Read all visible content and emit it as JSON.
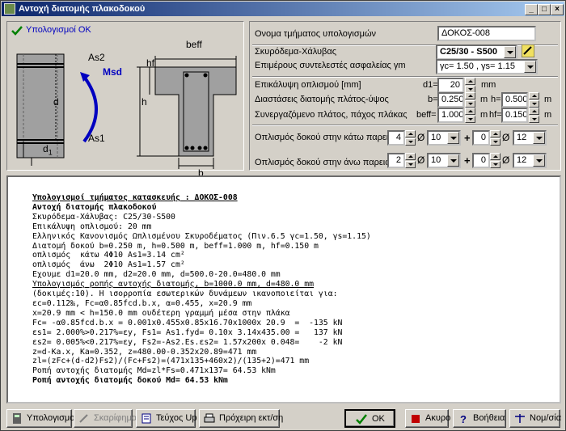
{
  "window": {
    "title": "Αντοχή διατομής πλακοδοκού",
    "controls": [
      "_",
      "□",
      "×"
    ]
  },
  "status": {
    "text": "Υπολογισμοί ΟΚ"
  },
  "diagram": {
    "labels": {
      "as2": "As2",
      "as1": "As1",
      "msd": "Msd",
      "d": "d",
      "d1": "d",
      "d1_sub": "1",
      "beff": "beff",
      "hf": "hf",
      "h": "h",
      "b": "b"
    }
  },
  "form": {
    "name_label": "Ονομα τμήματος υπολογισμών",
    "name_value": "ΔΟΚΟΣ-008",
    "concrete_label": "Σκυρόδεμα-Χάλυβας",
    "concrete_value": "C25/30 - S500",
    "factors_label": "Επιμέρους συντελεστές ασφαλείας γm",
    "factors_value": "γc= 1.50 , γs= 1.15",
    "cover_label": "Επικάλυψη οπλισμού [mm]",
    "cover_prefix": "d1=",
    "cover_value": "20",
    "cover_unit": "mm",
    "dims_label": "Διαστάσεις διατομής πλάτος-ύψος",
    "b_prefix": "b=",
    "b_value": "0.250",
    "b_unit": "m",
    "h_prefix": "h=",
    "h_value": "0.500",
    "h_unit": "m",
    "slab_label": "Συνεργαζόμενο πλάτος, πάχος πλάκας",
    "beff_prefix": "beff=",
    "beff_value": "1.000",
    "beff_unit": "m",
    "hf_prefix": "hf=",
    "hf_value": "0.150",
    "hf_unit": "m",
    "bottom_label": "Οπλισμός δοκού στην κάτω παρειά",
    "bottom_n1": "4",
    "bottom_d1": "10",
    "bottom_n2": "0",
    "bottom_d2": "12",
    "top_label": "Οπλισμός δοκού στην άνω παρειά",
    "top_n1": "2",
    "top_d1": "10",
    "top_n2": "0",
    "top_d2": "12",
    "phi": "Ø",
    "plus": "+"
  },
  "report": {
    "lines": [
      "Υπολογισμοί τμήματος κατασκευής : ΔΟΚΟΣ-008",
      "Αντοχή διατομής πλακοδοκού",
      "Σκυρόδεμα-Χάλυβας: C25/30-S500",
      "Επικάλυψη οπλισμού: 20 mm",
      "Ελληνικός Κανονισμός Ωπλισμένου Σκυροδέματος (Πιν.6.5 γc=1.50, γs=1.15)",
      "Διατομή δοκού b=0.250 m, h=0.500 m, beff=1.000 m, hf=0.150 m",
      "οπλισμός  κάτω 4Φ10 As1=3.14 cm²",
      "οπλισμός  άνω  2Φ10 As1=1.57 cm²",
      "Εχουμε d1=20.0 mm, d2=20.0 mm, d=500.0-20.0=480.0 mm",
      "Υπολογισμός ροπής αντοχής διατομής, b=1000.0 mm, d=480.0 mm",
      "(δοκιμές:10). Η ισορροπία εσωτερικών δυνάμεων ικανοποιείται για:",
      "εc=0.112‰, Fc=α0.85fcd.b.x, α=0.455, x=20.9 mm",
      "x=20.9 mm < h=150.0 mm ουδέτερη γραμμή μέσα στην πλάκα",
      "Fc= -α0.85fcd.b.x = 0.001x0.455x0.85x16.70x1000x 20.9  =  -135 kN",
      "εs1= 2.000%>0.217%=εy, Fs1= As1.fyd= 0.10x 3.14x435.00 =   137 kN",
      "εs2= 0.005%<0.217%=εy, Fs2=-As2.Es.εs2= 1.57x200x 0.048=    -2 kN",
      "z=d-Ka.x, Ka=0.352, z=480.00-0.352x20.89=471 mm",
      "zl=(zFc+(d-d2)Fs2)/(Fc+Fs2)=(471x135+460x2)/(135+2)=471 mm",
      "Ροπή αντοχής διατομής Md=zl*Fs=0.471x137= 64.53 kNm",
      "Ροπή αντοχής διατομής δοκού Md= 64.53 kNm"
    ]
  },
  "buttons": {
    "calc": "Υπολογισμοί",
    "sketch": "Σκαρίφημα",
    "report": "Τεύχος Up",
    "print": "Πρόχειρη εκτ/ση",
    "ok": "OK",
    "cancel": "Ακυρο",
    "help": "Βοήθεια",
    "units": "Νομ/σία"
  }
}
